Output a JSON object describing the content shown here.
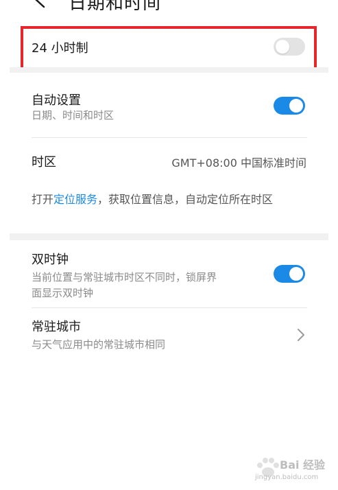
{
  "header": {
    "title": "日期和时间",
    "back_icon": "back-arrow-icon"
  },
  "hour24": {
    "label": "24 小时制",
    "enabled": false
  },
  "auto_set": {
    "label": "自动设置",
    "subtitle": "日期、时间和时区",
    "enabled": true
  },
  "timezone": {
    "label": "时区",
    "value": "GMT+08:00 中国标准时间"
  },
  "location_info": {
    "prefix": "打开",
    "link": "定位服务",
    "suffix": "，获取位置信息，自动定位所在时区"
  },
  "dual_clock": {
    "label": "双时钟",
    "subtitle_line1": "当前位置与常驻城市时区不同时，锁屏界",
    "subtitle_line2": "面显示双时钟",
    "enabled": true
  },
  "home_city": {
    "label": "常驻城市",
    "subtitle": "与天气应用中的常驻城市相同",
    "icon": "chevron-right-icon"
  },
  "watermark": {
    "text": "Bai 经验",
    "url": "jingyan.baidu.com"
  },
  "colors": {
    "accent": "#1b8ae6",
    "highlight_border": "#e5262b",
    "toggle_off": "#e3e3e3"
  }
}
